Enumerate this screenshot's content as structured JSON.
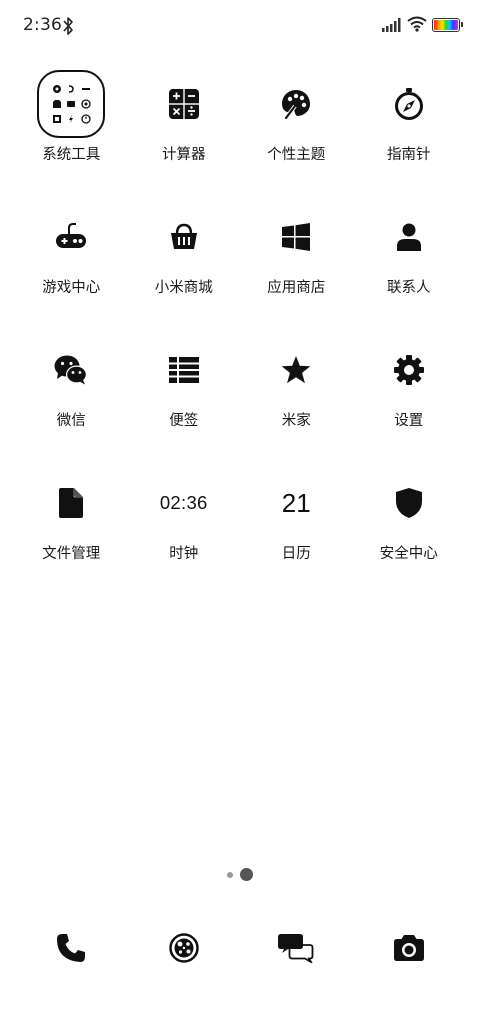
{
  "status_bar": {
    "time": "2:36",
    "icons": [
      "bluetooth-icon",
      "signal-icon",
      "wifi-icon",
      "battery-icon"
    ]
  },
  "apps": [
    {
      "label": "系统工具",
      "icon": "folder-icon"
    },
    {
      "label": "计算器",
      "icon": "calculator-icon"
    },
    {
      "label": "个性主题",
      "icon": "palette-icon"
    },
    {
      "label": "指南针",
      "icon": "compass-icon"
    },
    {
      "label": "游戏中心",
      "icon": "gamepad-icon"
    },
    {
      "label": "小米商城",
      "icon": "basket-icon"
    },
    {
      "label": "应用商店",
      "icon": "windows-icon"
    },
    {
      "label": "联系人",
      "icon": "person-icon"
    },
    {
      "label": "微信",
      "icon": "wechat-icon"
    },
    {
      "label": "便签",
      "icon": "list-icon"
    },
    {
      "label": "米家",
      "icon": "star-icon"
    },
    {
      "label": "设置",
      "icon": "gear-icon"
    },
    {
      "label": "文件管理",
      "icon": "file-icon"
    },
    {
      "label": "时钟",
      "icon": "clock-icon",
      "face_text": "02:36"
    },
    {
      "label": "日历",
      "icon": "calendar-icon",
      "face_text": "21"
    },
    {
      "label": "安全中心",
      "icon": "shield-icon"
    }
  ],
  "page_indicator": {
    "pages": 2,
    "current": 2
  },
  "dock": [
    {
      "icon": "phone-icon"
    },
    {
      "icon": "browser-icon"
    },
    {
      "icon": "messages-icon"
    },
    {
      "icon": "camera-icon"
    }
  ],
  "colors": {
    "icon": "#111111",
    "background": "#ffffff",
    "dot_active": "#555555",
    "dot_inactive": "#9a9a9a"
  }
}
